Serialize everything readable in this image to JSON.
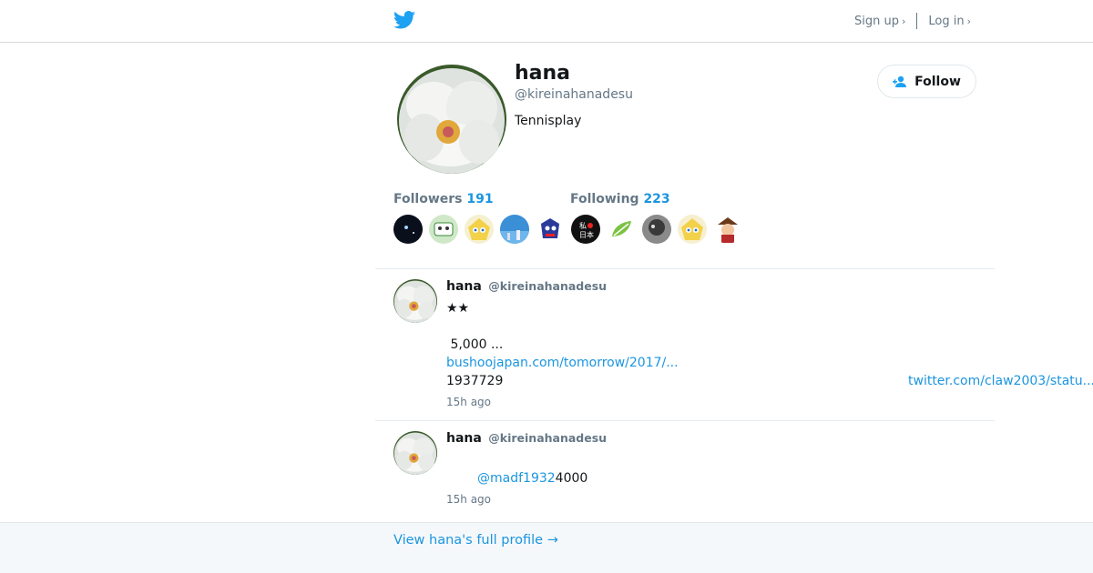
{
  "header": {
    "signup_label": "Sign up",
    "login_label": "Log in"
  },
  "profile": {
    "name": "hana",
    "handle": "@kireinahanadesu",
    "bio": "Tennisplay",
    "follow_label": "Follow",
    "followers_label": "Followers",
    "followers_count": "191",
    "following_label": "Following",
    "following_count": "223"
  },
  "tweets": [
    {
      "name": "hana",
      "handle": "@kireinahanadesu",
      "line1": "★★",
      "line2": " 5,000 ...",
      "link": "bushoojapan.com/tomorrow/2017/...",
      "line4": "1937729",
      "link_right": "twitter.com/claw2003/statu...",
      "time": "15h ago"
    },
    {
      "name": "hana",
      "handle": "@kireinahanadesu",
      "mention": "@madf1932",
      "tail": "4000",
      "time": "15h ago"
    }
  ],
  "footer": {
    "link": "View hana's full profile →"
  }
}
